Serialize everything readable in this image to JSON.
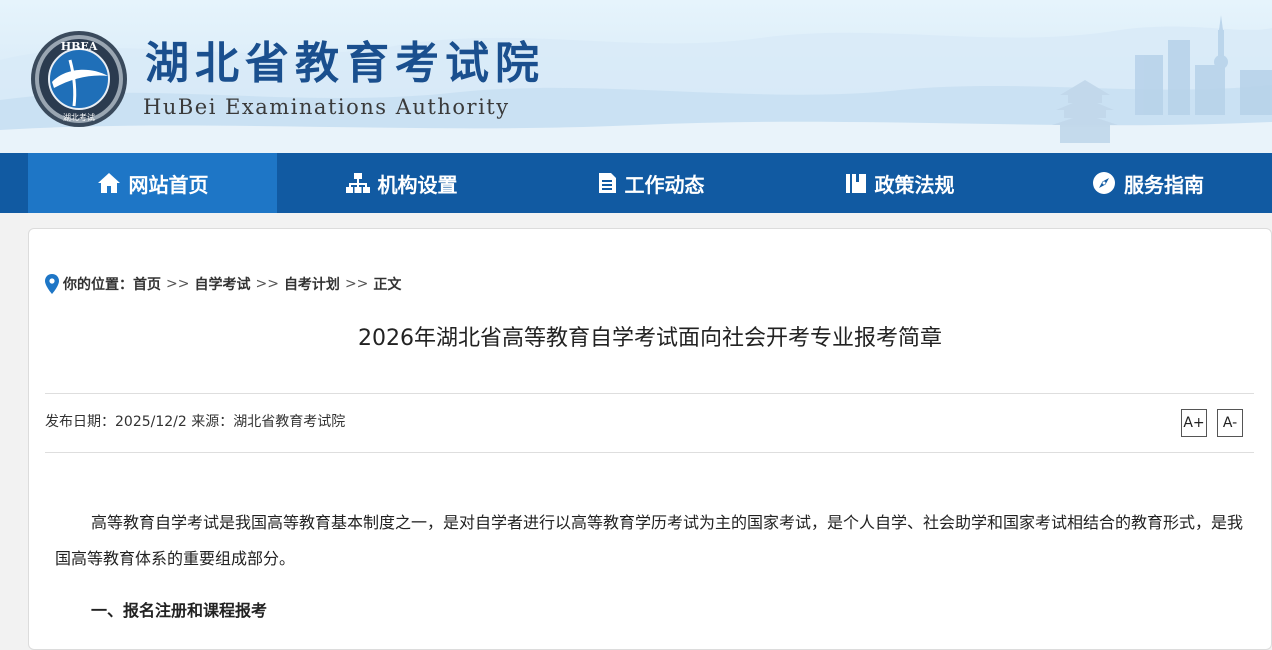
{
  "site": {
    "title": "湖北省教育考试院",
    "subtitle": "HuBei Examinations Authority",
    "logo_text": "HBEA",
    "logo_bottom_text": "湖北考试"
  },
  "nav": {
    "items": [
      {
        "label": "网站首页",
        "icon": "home-icon",
        "active": true
      },
      {
        "label": "机构设置",
        "icon": "org-chart-icon",
        "active": false
      },
      {
        "label": "工作动态",
        "icon": "document-icon",
        "active": false
      },
      {
        "label": "政策法规",
        "icon": "book-icon",
        "active": false
      },
      {
        "label": "服务指南",
        "icon": "compass-icon",
        "active": false
      }
    ]
  },
  "breadcrumb": {
    "label": "你的位置：",
    "items": [
      "首页",
      "自学考试",
      "自考计划",
      "正文"
    ],
    "separator": ">>"
  },
  "article": {
    "title": "2026年湖北省高等教育自学考试面向社会开考专业报考简章",
    "meta": "发布日期：2025/12/2 来源：湖北省教育考试院",
    "font_increase": "A+",
    "font_decrease": "A-",
    "paragraph": "高等教育自学考试是我国高等教育基本制度之一，是对自学者进行以高等教育学历考试为主的国家考试，是个人自学、社会助学和国家考试相结合的教育形式，是我国高等教育体系的重要组成部分。",
    "section_heading": "一、报名注册和课程报考"
  },
  "colors": {
    "nav_bg": "#115aa2",
    "nav_active": "#1e76c6",
    "title_blue": "#1a4f8e",
    "pin_blue": "#1e76c6"
  }
}
